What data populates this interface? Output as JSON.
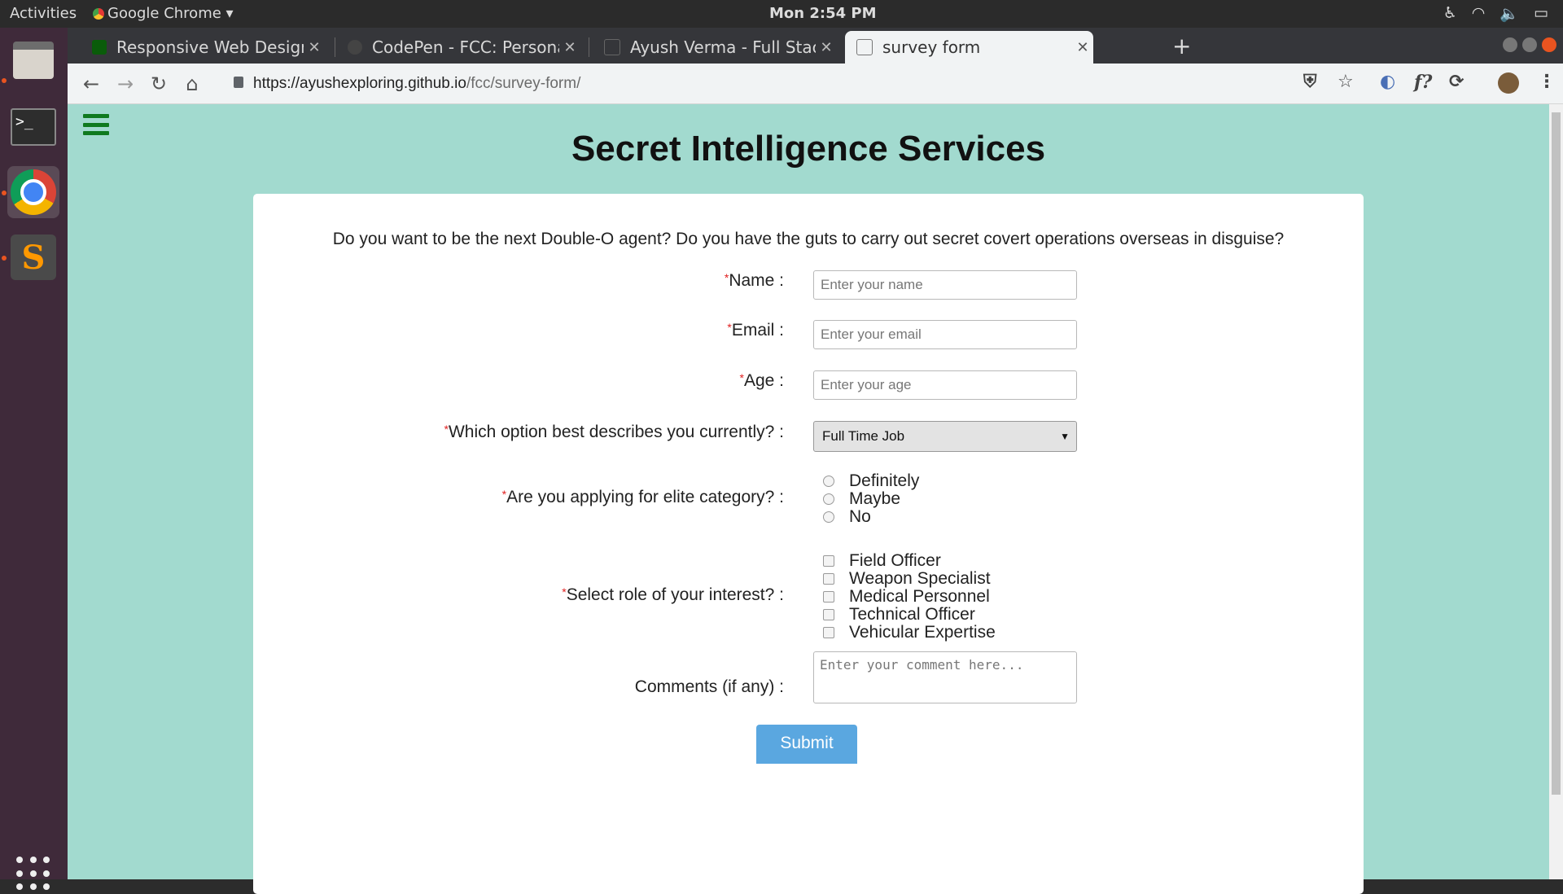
{
  "topbar": {
    "activities": "Activities",
    "app_name": "Google Chrome ▾",
    "clock": "Mon  2:54 PM"
  },
  "browser": {
    "tabs": [
      {
        "title": "Responsive Web Design Projects",
        "favicon_color": "#0a5c0a"
      },
      {
        "title": "CodePen - FCC: Personal Portfolio",
        "favicon_color": "#444444"
      },
      {
        "title": "Ayush Verma - Full Stack Web Developer",
        "favicon_color": "#555555"
      },
      {
        "title": "survey form",
        "favicon_color": "#888888"
      }
    ],
    "active_tab": 3,
    "url_host": "https://ayushexploring.github.io",
    "url_path": "/fcc/survey-form/"
  },
  "page": {
    "title": "Secret Intelligence Services",
    "description": "Do you want to be the next Double-O agent? Do you have the guts to carry out secret covert operations overseas in disguise?",
    "required_mark": "*",
    "name": {
      "label": "Name :",
      "placeholder": "Enter your name"
    },
    "email": {
      "label": "Email :",
      "placeholder": "Enter your email"
    },
    "age": {
      "label": "Age :",
      "placeholder": "Enter your age"
    },
    "status": {
      "label": "Which option best describes you currently? :",
      "selected": "Full Time Job"
    },
    "elite": {
      "label": "Are you applying for elite category? :",
      "options": [
        "Definitely",
        "Maybe",
        "No"
      ]
    },
    "roles": {
      "label": "Select role of your interest? :",
      "options": [
        "Field Officer",
        "Weapon Specialist",
        "Medical Personnel",
        "Technical Officer",
        "Vehicular Expertise"
      ]
    },
    "comments": {
      "label": "Comments (if any) :",
      "placeholder": "Enter your comment here..."
    },
    "submit_label": "Submit"
  },
  "colors": {
    "page_background": "#a2dacf",
    "hamburger": "#0f7a1f",
    "submit": "#5aa7e0",
    "required": "#e02020"
  }
}
